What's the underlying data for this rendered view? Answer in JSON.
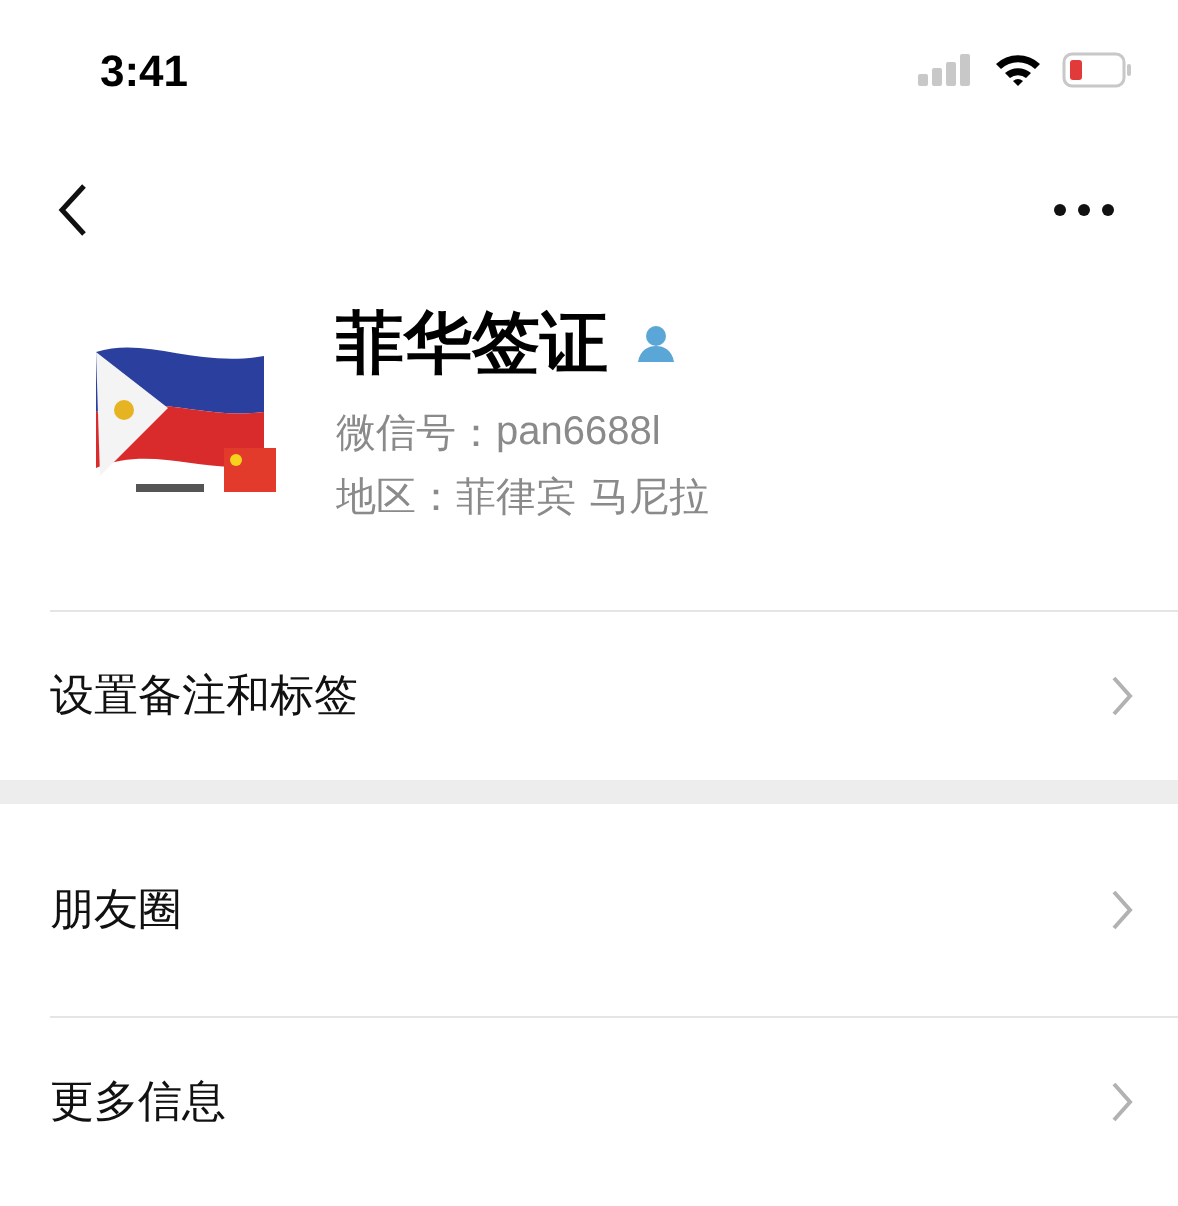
{
  "status_bar": {
    "time": "3:41"
  },
  "profile": {
    "name": "菲华签证",
    "wechat_id_label": "微信号：",
    "wechat_id": "pan6688l",
    "region_label": "地区：",
    "region": "菲律宾 马尼拉"
  },
  "groups": [
    {
      "rows": [
        {
          "label": "设置备注和标签"
        }
      ]
    },
    {
      "rows": [
        {
          "label": "朋友圈"
        },
        {
          "label": "更多信息"
        }
      ]
    }
  ]
}
